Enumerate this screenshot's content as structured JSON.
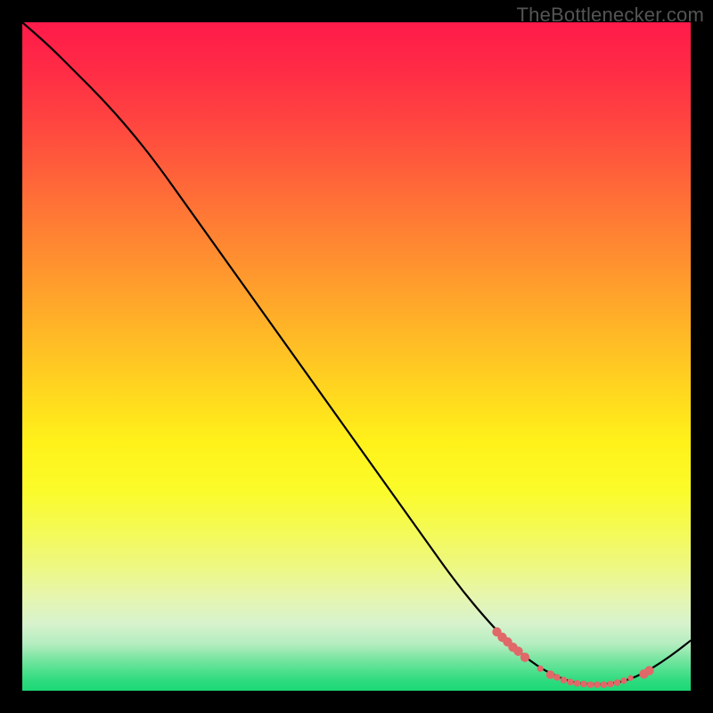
{
  "attribution": "TheBottlenecker.com",
  "chart_data": {
    "type": "line",
    "title": "",
    "xlabel": "",
    "ylabel": "",
    "x_range": [
      0,
      100
    ],
    "y_range": [
      0,
      100
    ],
    "curve": [
      [
        0,
        100
      ],
      [
        4,
        96.5
      ],
      [
        8,
        92.5
      ],
      [
        12,
        88.5
      ],
      [
        16,
        84
      ],
      [
        20,
        79
      ],
      [
        25,
        72
      ],
      [
        30,
        65
      ],
      [
        35,
        58
      ],
      [
        40,
        51
      ],
      [
        45,
        44
      ],
      [
        50,
        37
      ],
      [
        55,
        30
      ],
      [
        60,
        23
      ],
      [
        65,
        16
      ],
      [
        70,
        10
      ],
      [
        74,
        6
      ],
      [
        78,
        3
      ],
      [
        82,
        1.3
      ],
      [
        85,
        0.9
      ],
      [
        88,
        1.0
      ],
      [
        91,
        1.7
      ],
      [
        94,
        3.2
      ],
      [
        97,
        5.2
      ],
      [
        100,
        7.5
      ]
    ],
    "markers": [
      {
        "x": 71.0,
        "y": 8.8,
        "r": 5.2
      },
      {
        "x": 71.8,
        "y": 8.0,
        "r": 5.2
      },
      {
        "x": 72.6,
        "y": 7.3,
        "r": 5.2
      },
      {
        "x": 73.4,
        "y": 6.5,
        "r": 5.2
      },
      {
        "x": 74.2,
        "y": 5.9,
        "r": 5.2
      },
      {
        "x": 75.2,
        "y": 5.0,
        "r": 5.2
      },
      {
        "x": 77.5,
        "y": 3.3,
        "r": 3.6
      },
      {
        "x": 79.0,
        "y": 2.4,
        "r": 4.8
      },
      {
        "x": 80.0,
        "y": 2.0,
        "r": 3.8
      },
      {
        "x": 81.0,
        "y": 1.6,
        "r": 3.8
      },
      {
        "x": 82.0,
        "y": 1.3,
        "r": 3.8
      },
      {
        "x": 83.0,
        "y": 1.1,
        "r": 3.8
      },
      {
        "x": 84.0,
        "y": 1.0,
        "r": 3.8
      },
      {
        "x": 85.0,
        "y": 0.9,
        "r": 3.8
      },
      {
        "x": 86.0,
        "y": 0.9,
        "r": 3.8
      },
      {
        "x": 87.0,
        "y": 0.9,
        "r": 3.8
      },
      {
        "x": 88.0,
        "y": 1.0,
        "r": 3.8
      },
      {
        "x": 89.0,
        "y": 1.2,
        "r": 3.8
      },
      {
        "x": 90.0,
        "y": 1.5,
        "r": 3.6
      },
      {
        "x": 91.0,
        "y": 1.9,
        "r": 3.2
      },
      {
        "x": 93.0,
        "y": 2.5,
        "r": 5.2
      },
      {
        "x": 93.8,
        "y": 3.0,
        "r": 5.2
      }
    ],
    "background": "rainbow-gradient",
    "note": "Axes have no visible tick labels; values estimated on 0-100 scale."
  }
}
